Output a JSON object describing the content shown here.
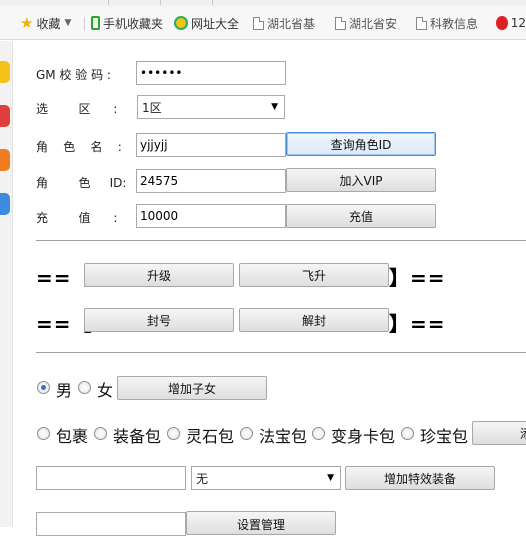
{
  "bookmarks_bar": {
    "items": [
      {
        "label": "收藏",
        "icon": "star-icon",
        "dropdown": true
      },
      {
        "label": "手机收藏夹",
        "icon": "phone-icon"
      },
      {
        "label": "网址大全",
        "icon": "globe-icon"
      },
      {
        "label": "湖北省基",
        "icon": "page-icon"
      },
      {
        "label": "湖北省安",
        "icon": "page-icon"
      },
      {
        "label": "科教信息",
        "icon": "page-icon"
      },
      {
        "label": "12",
        "icon": "360-icon"
      }
    ]
  },
  "form": {
    "gm_label": "GM 校 验 码 :",
    "gm_value": "••••••",
    "server_label": "选        区      :",
    "server_value": "1区",
    "role_label": "角    色    名    :",
    "role_value": "yjjyjj",
    "query_button": "查询角色ID",
    "roleid_label": "角        色     ID:",
    "roleid_value": "24575",
    "vip_button": "加入VIP",
    "recharge_label": "充        值      :",
    "recharge_value": "10000",
    "recharge_button": "充值"
  },
  "actions": {
    "bracket_open": "==【",
    "bracket_close": "】==",
    "upgrade_button": "升级",
    "fly_button": "飞升",
    "ban_button": "封号",
    "unban_button": "解封"
  },
  "gender": {
    "male": "男",
    "female": "女",
    "selected": "male",
    "add_child_button": "增加子女"
  },
  "bags": {
    "items": [
      "包裹",
      "装备包",
      "灵石包",
      "法宝包",
      "变身卡包",
      "珍宝包"
    ],
    "trailing_button": "添"
  },
  "equip": {
    "input_value": "",
    "select_value": "无",
    "add_button": "增加特效装备"
  },
  "admin": {
    "input_value": "",
    "set_button": "设置管理"
  }
}
